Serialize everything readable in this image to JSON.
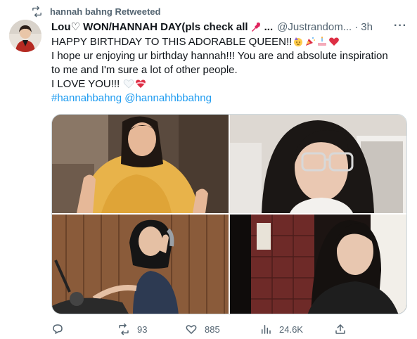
{
  "retweet": {
    "label": "hannah bahng Retweeted",
    "icon": "retweet-icon"
  },
  "tweet": {
    "display_name": "Lou♡ WON/HANNAH DAY(pls check all",
    "name_overflow": "...",
    "handle": "@Justrandom...",
    "separator": "·",
    "time": "3h",
    "more": "···",
    "line1": "HAPPY BIRTHDAY TO THIS ADORABLE QUEEN!!",
    "line2": "I hope ur enjoying ur birthday hannah!!! You are and absolute inspiration",
    "line3": "to me and I'm sure a lot of other people.",
    "line4": "I LOVE YOU!!!",
    "hashtags": "#hannahbahng @hannahhbbahng"
  },
  "stats": {
    "retweets": "93",
    "likes": "885",
    "views": "24.6K"
  },
  "colors": {
    "link": "#1d9bf0",
    "muted": "#536471",
    "text": "#0f1419",
    "border": "#cfd9de"
  }
}
